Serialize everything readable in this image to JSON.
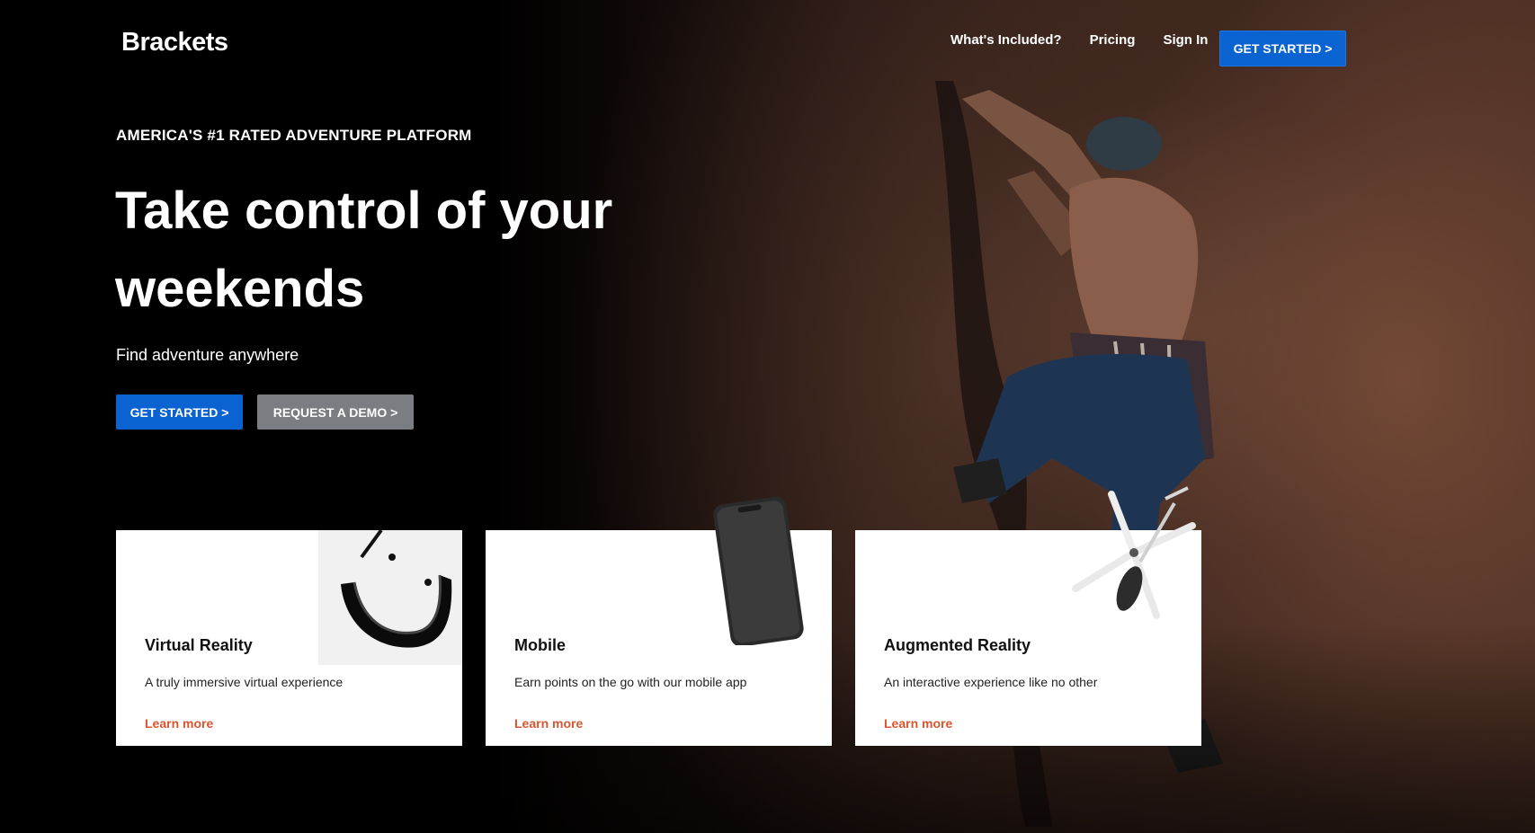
{
  "brand": {
    "logo": "Brackets"
  },
  "nav": {
    "links": [
      "What's Included?",
      "Pricing",
      "Sign In"
    ],
    "cta": "GET STARTED >"
  },
  "hero": {
    "eyebrow": "AMERICA'S #1 RATED ADVENTURE PLATFORM",
    "headline": "Take control of your weekends",
    "subhead": "Find adventure anywhere",
    "primary_button": "GET STARTED >",
    "secondary_button": "REQUEST A DEMO >"
  },
  "cards": [
    {
      "title": "Virtual Reality",
      "description": "A truly immersive virtual experience",
      "link": "Learn more",
      "icon": "vr-headset-icon"
    },
    {
      "title": "Mobile",
      "description": "Earn points on the go with our mobile app",
      "link": "Learn more",
      "icon": "smartphone-icon"
    },
    {
      "title": "Augmented Reality",
      "description": "An interactive experience like no other",
      "link": "Learn more",
      "icon": "drone-helicopter-icon"
    }
  ],
  "colors": {
    "primary_blue": "#0a63d1",
    "secondary_gray": "#7a7d82",
    "link_orange": "#d9552f",
    "card_bg": "#ffffff"
  }
}
